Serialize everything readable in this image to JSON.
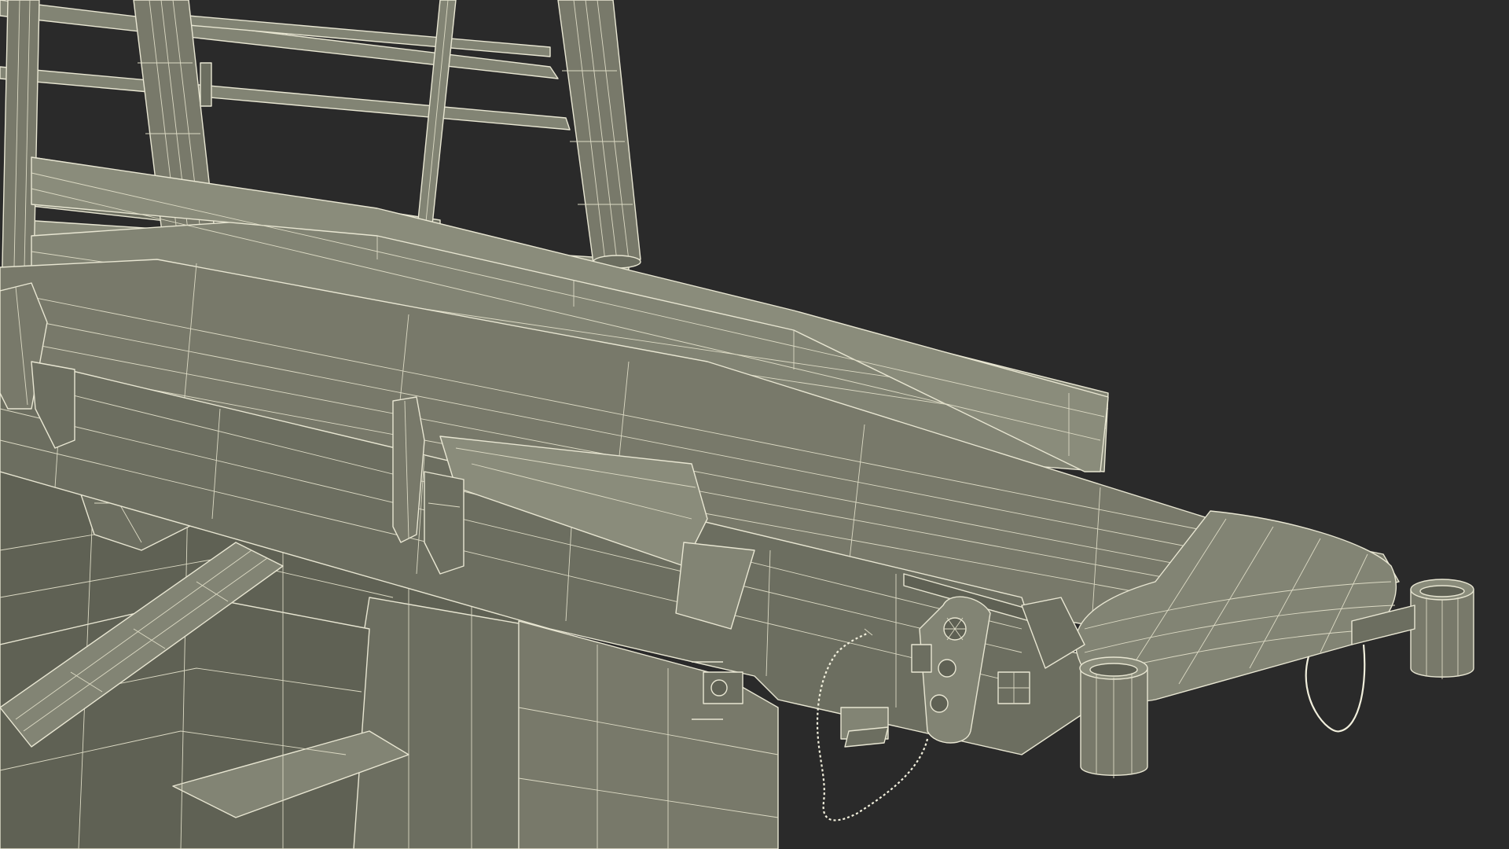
{
  "scene": {
    "background": "#2a2a2a",
    "model_fill": "#78796a",
    "wire_color": "#e8e6d2"
  }
}
